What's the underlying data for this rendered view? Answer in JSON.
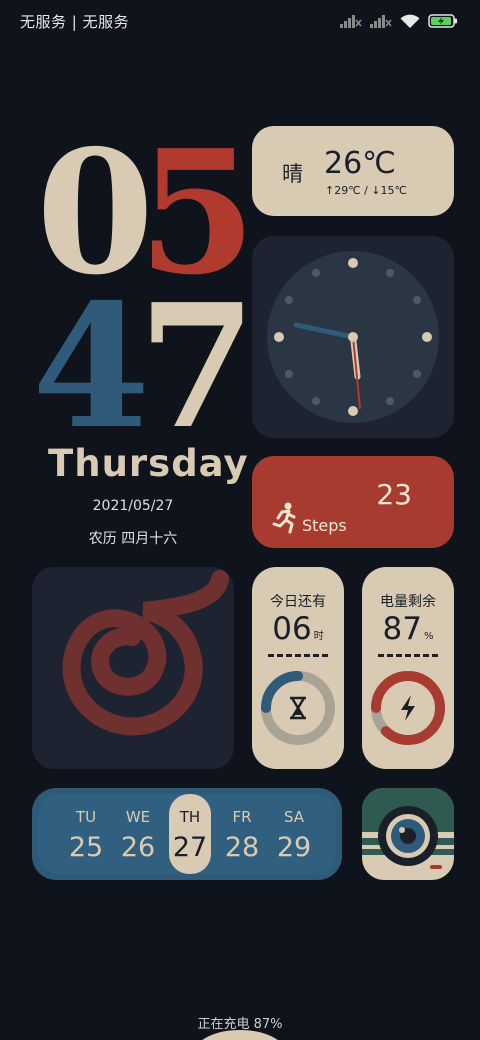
{
  "status_bar": {
    "carrier": "无服务 | 无服务",
    "icons": [
      "signal-no-service-icon",
      "signal-no-service-icon",
      "wifi-icon",
      "battery-charging-icon"
    ]
  },
  "clock": {
    "hour_tens": "0",
    "hour_ones": "5",
    "minute_tens": "4",
    "minute_ones": "7",
    "weekday": "Thursday",
    "date": "2021/05/27",
    "lunar": "农历 四月十六"
  },
  "weather": {
    "condition": "晴",
    "temperature": "26℃",
    "range": "↑29℃ / ↓15℃"
  },
  "analog_clock": {
    "hours": 5,
    "minutes": 47
  },
  "steps": {
    "count": "23",
    "label": "Steps",
    "icon": "runner-icon"
  },
  "time_remaining": {
    "title": "今日还有",
    "value": "06",
    "unit": "时",
    "progress": 0.25,
    "icon": "hourglass-icon"
  },
  "battery": {
    "title": "电量剩余",
    "value": "87",
    "unit": "%",
    "progress": 0.87,
    "icon": "bolt-icon"
  },
  "week": {
    "days": [
      {
        "wd": "TU",
        "dn": "25"
      },
      {
        "wd": "WE",
        "dn": "26"
      },
      {
        "wd": "TH",
        "dn": "27"
      },
      {
        "wd": "FR",
        "dn": "28"
      },
      {
        "wd": "SA",
        "dn": "29"
      }
    ],
    "active_index": 2
  },
  "charging_text": "正在充电 87%",
  "colors": {
    "cream": "#d9cbb3",
    "red": "#a83b30",
    "blue": "#2e5a78",
    "bg": "#0f131b",
    "card": "#1d2330"
  }
}
